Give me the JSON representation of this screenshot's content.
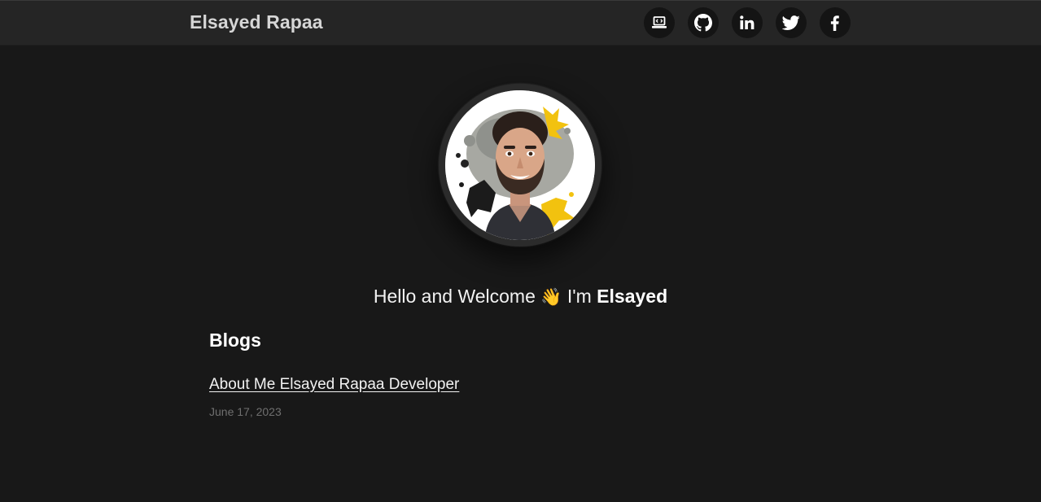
{
  "header": {
    "site_title": "Elsayed Rapaa",
    "social_links": [
      {
        "icon": "laptop-code-icon",
        "label": "Portfolio"
      },
      {
        "icon": "github-icon",
        "label": "GitHub"
      },
      {
        "icon": "linkedin-icon",
        "label": "LinkedIn"
      },
      {
        "icon": "twitter-icon",
        "label": "Twitter"
      },
      {
        "icon": "facebook-icon",
        "label": "Facebook"
      }
    ]
  },
  "hero": {
    "greeting": "Hello and Welcome",
    "wave_emoji": "👋",
    "intro": "I'm",
    "name": "Elsayed"
  },
  "blogs": {
    "heading": "Blogs",
    "posts": [
      {
        "title": "About Me Elsayed Rapaa Developer",
        "date": "June 17, 2023"
      }
    ]
  },
  "colors": {
    "background": "#181818",
    "navbar": "#252525",
    "icon_circle": "#141414",
    "date_text": "#6f6f6f"
  }
}
